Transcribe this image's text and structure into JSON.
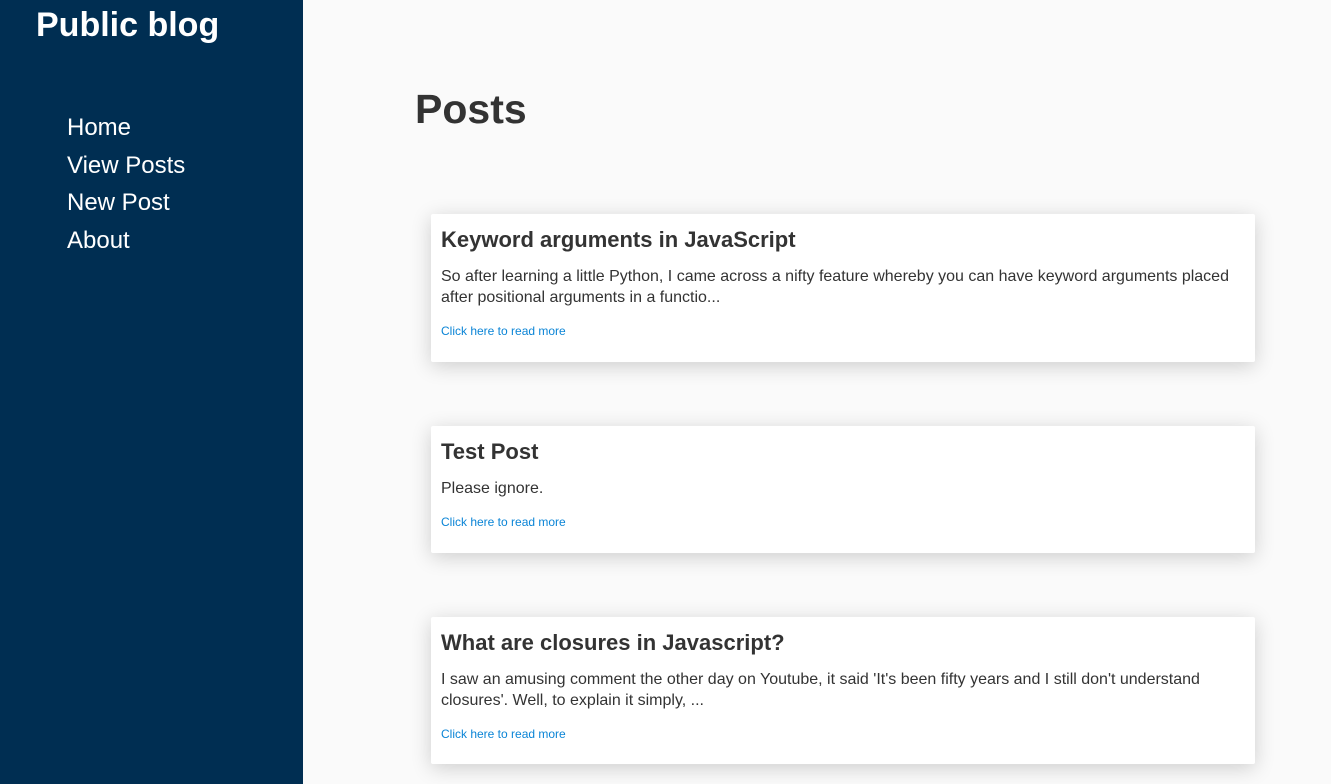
{
  "sidebar": {
    "site_title": "Public blog",
    "nav": [
      {
        "label": "Home"
      },
      {
        "label": "View Posts"
      },
      {
        "label": "New Post"
      },
      {
        "label": "About"
      }
    ]
  },
  "main": {
    "title": "Posts",
    "posts": [
      {
        "title": "Keyword arguments in JavaScript",
        "excerpt": "So after learning a little Python, I came across a nifty feature whereby you can have keyword arguments placed after positional arguments in a functio...",
        "link": "Click here to read more"
      },
      {
        "title": "Test Post",
        "excerpt": "Please ignore.",
        "link": "Click here to read more"
      },
      {
        "title": "What are closures in Javascript?",
        "excerpt": "I saw an amusing comment the other day on Youtube, it said 'It's been fifty years and I still don't understand closures'. Well, to explain it simply, ...",
        "link": "Click here to read more"
      }
    ]
  },
  "colors": {
    "sidebar_bg": "#002e52",
    "page_bg": "#fafafa",
    "text": "#333333",
    "link": "#0a84d6"
  }
}
